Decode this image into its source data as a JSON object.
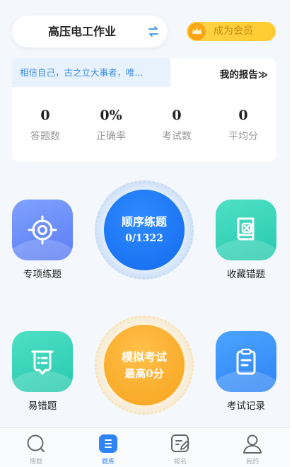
{
  "header": {
    "subject": "高压电工作业",
    "vip_label": "成为会员"
  },
  "report": {
    "motto": "相信自己，古之立大事者，唯...",
    "link_label": "我的报告≫",
    "stats": [
      {
        "value": "0",
        "label": "答题数"
      },
      {
        "value": "0%",
        "label": "正确率"
      },
      {
        "value": "0",
        "label": "考试数"
      },
      {
        "value": "0",
        "label": "平均分"
      }
    ]
  },
  "features": {
    "special": "专项练题",
    "collect": "收藏错题",
    "error_prone": "易错题",
    "exam_records": "考试记录"
  },
  "sequential": {
    "title": "顺序练题",
    "progress": "0/1322"
  },
  "mock_exam": {
    "title": "模拟考试",
    "best": "最高0分"
  },
  "tabbar": {
    "tabs": [
      {
        "label": "搜题",
        "icon": "search-icon"
      },
      {
        "label": "题库",
        "icon": "question-bank-icon"
      },
      {
        "label": "报名",
        "icon": "signup-icon"
      },
      {
        "label": "我的",
        "icon": "user-icon"
      }
    ],
    "active_index": 1,
    "accent": "#2f84f5"
  },
  "colors": {
    "primary_blue": "#1369ee",
    "orange": "#f7a21b",
    "teal": "#26c9ad",
    "purple": "#5b7cf3",
    "vip_yellow": "#ffcb2e"
  }
}
